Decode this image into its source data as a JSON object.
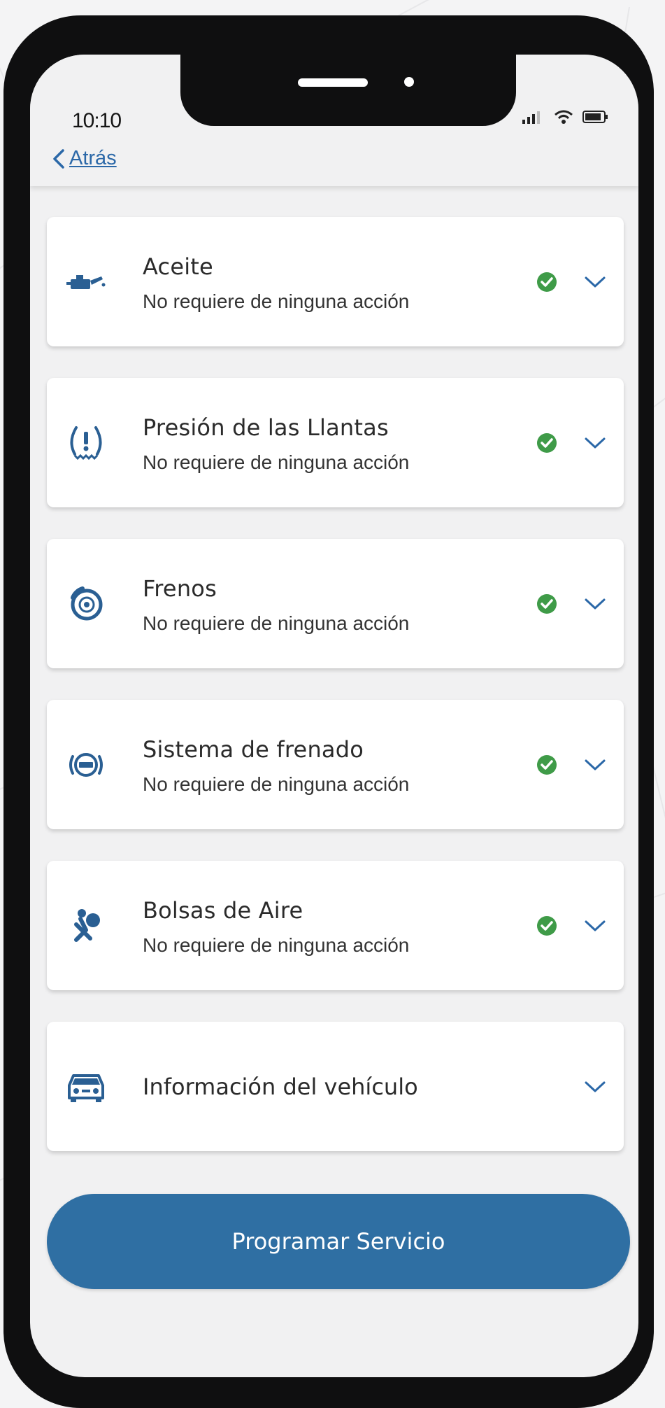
{
  "status_bar": {
    "time": "10:10"
  },
  "nav": {
    "back_label": "Atrás"
  },
  "items": [
    {
      "title": "Aceite",
      "status": "No requiere de ninguna acción",
      "icon": "oil-can-icon",
      "ok": true
    },
    {
      "title": "Presión de las Llantas",
      "status": "No requiere de ninguna acción",
      "icon": "tire-pressure-icon",
      "ok": true
    },
    {
      "title": "Frenos",
      "status": "No requiere de ninguna acción",
      "icon": "brake-disc-icon",
      "ok": true
    },
    {
      "title": "Sistema de frenado",
      "status": "No requiere de ninguna acción",
      "icon": "abs-icon",
      "ok": true
    },
    {
      "title": "Bolsas de Aire",
      "status": "No requiere de ninguna acción",
      "icon": "airbag-icon",
      "ok": true
    },
    {
      "title": "Información del vehículo",
      "icon": "car-info-icon"
    }
  ],
  "cta": {
    "label": "Programar Servicio"
  },
  "colors": {
    "accent": "#2f6fa3",
    "link": "#2b68a8",
    "ok_green": "#3f9b48",
    "icon_blue": "#2a5f93"
  }
}
